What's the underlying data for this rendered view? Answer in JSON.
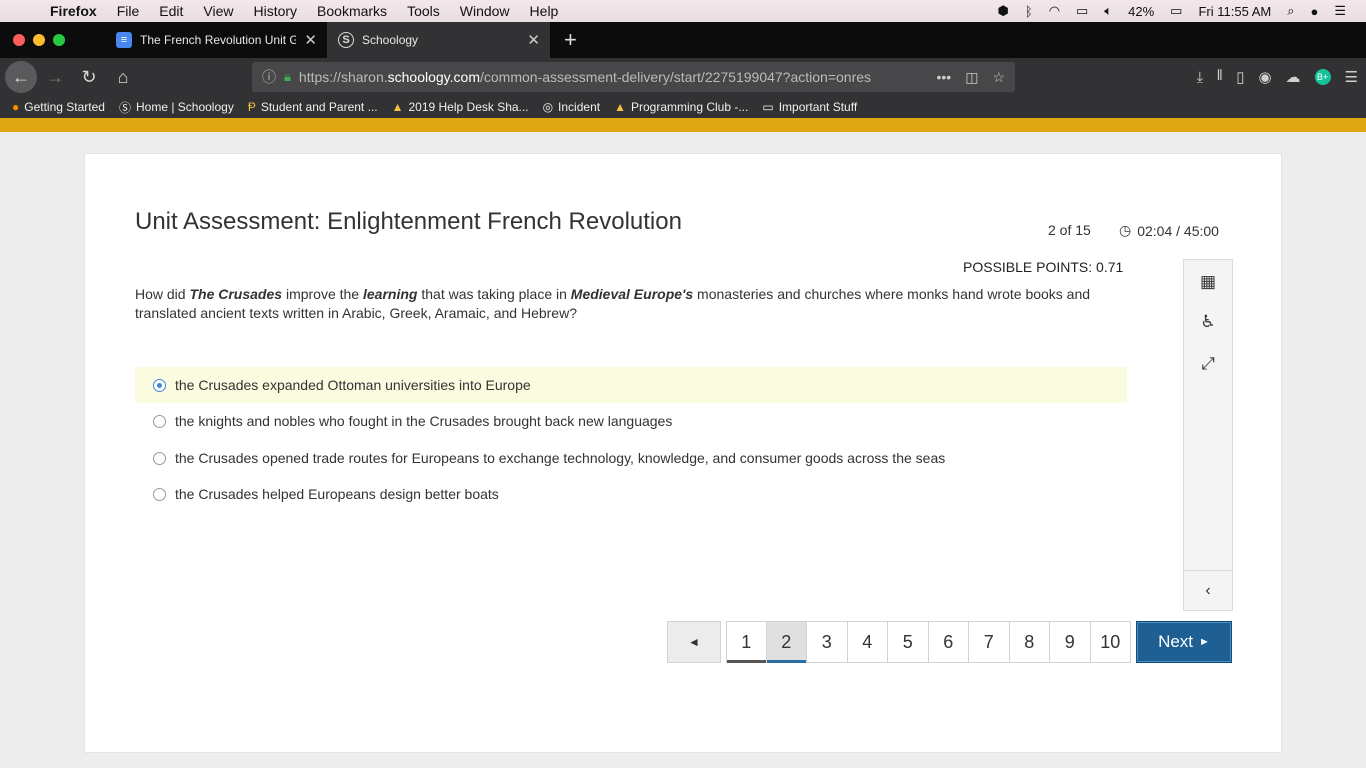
{
  "menubar": {
    "app": "Firefox",
    "items": [
      "File",
      "Edit",
      "View",
      "History",
      "Bookmarks",
      "Tools",
      "Window",
      "Help"
    ],
    "battery": "42%",
    "clock": "Fri 11:55 AM"
  },
  "tabs": [
    {
      "title": "The French Revolution Unit Gui",
      "icon": "docs-icon"
    },
    {
      "title": "Schoology",
      "icon": "schoology-icon"
    }
  ],
  "address": {
    "prefix": "https://sharon.",
    "domain": "schoology.com",
    "path": "/common-assessment-delivery/start/2275199047?action=onres"
  },
  "bookmarks": [
    {
      "label": "Getting Started",
      "icon": "firefox-icon"
    },
    {
      "label": "Home | Schoology",
      "icon": "schoology-icon"
    },
    {
      "label": "Student and Parent ...",
      "icon": "powerschool-icon"
    },
    {
      "label": "2019 Help Desk Sha...",
      "icon": "drive-icon"
    },
    {
      "label": "Incident",
      "icon": "globe-icon"
    },
    {
      "label": "Programming Club -...",
      "icon": "drive-icon"
    },
    {
      "label": "Important Stuff",
      "icon": "folder-icon"
    }
  ],
  "assessment": {
    "title": "Unit Assessment: Enlightenment French Revolution",
    "progress": "2 of 15",
    "timer": "02:04 / 45:00",
    "points": "POSSIBLE POINTS: 0.71",
    "question": {
      "p1": "How did ",
      "b1": "The Crusades",
      "p2": " improve the ",
      "b2": "learning",
      "p3": " that was taking place in ",
      "b3": "Medieval Europe's",
      "p4": " monasteries and churches where monks hand wrote books and translated ancient texts written in Arabic, Greek, Aramaic, and Hebrew?"
    },
    "choices": [
      "the Crusades expanded Ottoman universities into Europe",
      "the knights and nobles who fought in the Crusades brought back new languages",
      "the Crusades opened trade routes for Europeans to exchange technology, knowledge, and consumer goods across the seas",
      "the Crusades helped Europeans design better boats"
    ],
    "selected_choice": 0
  },
  "pager": {
    "prev": "◄",
    "pages": [
      "1",
      "2",
      "3",
      "4",
      "5",
      "6",
      "7",
      "8",
      "9",
      "10"
    ],
    "current": "2",
    "next": "Next",
    "next_arrow": "►"
  }
}
